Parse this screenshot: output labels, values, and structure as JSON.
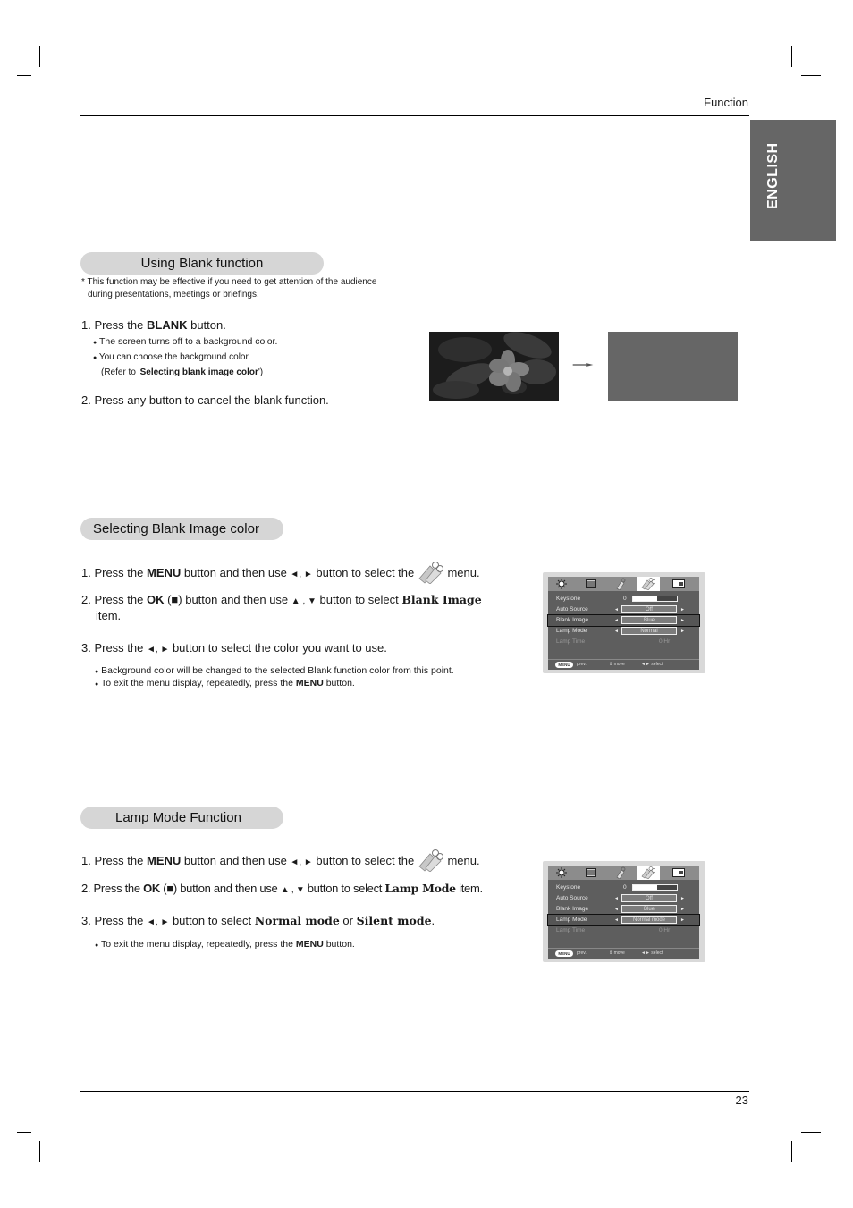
{
  "header": {
    "section": "Function",
    "page_number": "23",
    "language_tab": "ENGLISH"
  },
  "blank_section": {
    "title": "Using Blank function",
    "note_line1": "* This function may be effective if you need to get attention of the audience",
    "note_line2": "during presentations, meetings or briefings.",
    "step1": {
      "prefix": "1. Press the ",
      "key": "BLANK",
      "suffix": " button."
    },
    "bullet1": "The screen turns off to a background color.",
    "bullet2": "You can choose the background color.",
    "refer": {
      "prefix": "(Refer to '",
      "bold": "Selecting blank image color",
      "suffix": "')"
    },
    "step2": "2. Press any button to cancel the blank function.",
    "illustration": {
      "before": "photo-screen",
      "after": "blank-screen",
      "blank_color": "#666666"
    }
  },
  "color_section": {
    "title": "Selecting Blank Image color",
    "step1": {
      "a": "1. Press the ",
      "key": "MENU",
      "b": " button and then use ",
      "arrows": "◄, ►",
      "c": " button to select the ",
      "d": " menu."
    },
    "step2": {
      "a": "2. Press the ",
      "key": "OK",
      "b": " (■) button and then use ",
      "arrows": "▲ , ▼",
      "c": " button to select ",
      "item": "Blank Image",
      "d": "item."
    },
    "step3": {
      "a": "3. Press the ",
      "arrows": "◄, ►",
      "b": " button to select the color you want to use."
    },
    "bullet1": "Background color will be changed to the selected Blank function color from this point.",
    "bullet2": {
      "a": "To exit the menu display, repeatedly, press the ",
      "key": "MENU",
      "b": " button."
    }
  },
  "lamp_section": {
    "title": "Lamp Mode Function",
    "step1": {
      "a": "1. Press the ",
      "key": "MENU",
      "b": " button and then use ",
      "arrows": "◄, ►",
      "c": " button to select the ",
      "d": " menu."
    },
    "step2": {
      "a": "2. Press the ",
      "key": "OK",
      "b": " (■) button and then use ",
      "arrows": "▲ , ▼",
      "c": " button to select ",
      "item": "Lamp Mode",
      "d": " item."
    },
    "step3": {
      "a": "3. Press the ",
      "arrows": "◄, ►",
      "b": " button to select ",
      "opt1": "Normal mode",
      "or": " or ",
      "opt2": "Silent mode",
      "end": "."
    },
    "bullet1": {
      "a": "To exit the menu display, repeatedly, press the ",
      "key": "MENU",
      "b": " button."
    }
  },
  "osd1": {
    "rows": [
      {
        "label": "Keystone",
        "value": "0"
      },
      {
        "label": "Auto Source",
        "value": "Off"
      },
      {
        "label": "Blank Image",
        "value": "Blue"
      },
      {
        "label": "Lamp Mode",
        "value": "Normal"
      },
      {
        "label": "Lamp Time",
        "value": "0 Hr"
      }
    ],
    "keystone_fill": 0.55,
    "footer": {
      "menu": "MENU",
      "prev": "prev.",
      "move": "move",
      "select": "select"
    }
  },
  "osd2": {
    "rows": [
      {
        "label": "Keystone",
        "value": "0"
      },
      {
        "label": "Auto Source",
        "value": "Off"
      },
      {
        "label": "Blank Image",
        "value": "Blue"
      },
      {
        "label": "Lamp Mode",
        "value": "Normal mode"
      },
      {
        "label": "Lamp Time",
        "value": "0 Hr"
      }
    ],
    "keystone_fill": 0.55,
    "footer": {
      "menu": "MENU",
      "prev": "prev.",
      "move": "move",
      "select": "select"
    }
  },
  "glyphs": {
    "bullet": "●",
    "left": "◄",
    "right": "►",
    "updown": "⇕",
    "leftright": "◄►"
  }
}
